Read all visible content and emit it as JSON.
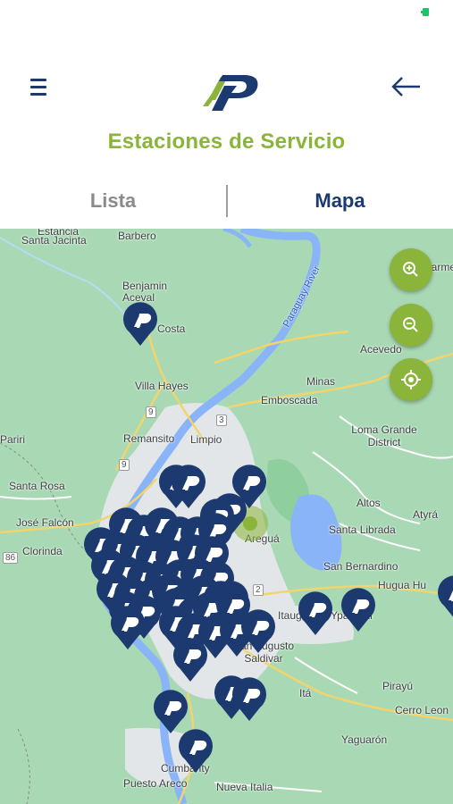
{
  "header": {
    "title": "Estaciones de Servicio"
  },
  "tabs": [
    {
      "label": "Lista",
      "active": false
    },
    {
      "label": "Mapa",
      "active": true
    }
  ],
  "icons": {
    "menu": "hamburger-menu-icon",
    "back": "arrow-left-icon",
    "zoom_in": "zoom-in-icon",
    "zoom_out": "zoom-out-icon",
    "locate": "my-location-icon",
    "station_pin": "map-pin-icon"
  },
  "colors": {
    "brand_green": "#8ab43a",
    "brand_blue": "#1d3a70",
    "inactive_tab": "#8a8a8a",
    "map_land": "#a8d8b3",
    "map_water": "#8ab4f8"
  },
  "map": {
    "river_label": "Paraguay River",
    "places": [
      "Estancia",
      "Santa Jacinta",
      "Barbero",
      "Benjamin Aceval",
      "Costa",
      "El Carmen",
      "Acevedo",
      "Villa Hayes",
      "Minas",
      "Emboscada",
      "Pariri",
      "Remansito",
      "Limpio",
      "Loma Grande District",
      "Santa Rosa",
      "José Falcón",
      "Clorinda",
      "Areguá",
      "Altos",
      "Atyrá",
      "Santa Librada",
      "San Bernardino",
      "Hugua Hu",
      "Itauguá",
      "Ypacaraí",
      "San Augusto Saldivar",
      "Pirayú",
      "Itá",
      "Cerro Leon",
      "Yaguarón",
      "Cumbarity",
      "Puesto Areco",
      "Nueva Italia"
    ],
    "road_numbers": [
      "9",
      "3",
      "9",
      "2",
      "86"
    ]
  }
}
